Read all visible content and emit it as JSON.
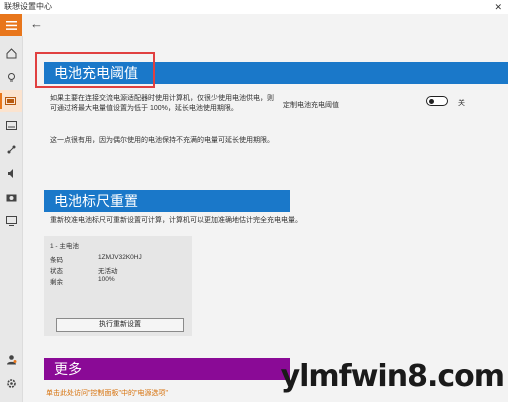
{
  "window": {
    "title": "联想设置中心",
    "close": "✕"
  },
  "nav": {
    "back": "←"
  },
  "section1": {
    "title": "电池充电阈值",
    "desc1": "如果主要在连接交流电源适配器时使用计算机，仅很少使用电池供电，则可通过将最大电量值设置为低于 100%，延长电池使用期限。",
    "desc2": "这一点很有用，因为偶尔使用的电池保持不充满的电量可延长使用期限。",
    "toggle_label": "定制电池充电阈值",
    "toggle_state": "关",
    "toggle_on": false
  },
  "section2": {
    "title": "电池标尺重置",
    "desc": "重新校准电池标尺可重新设置可计算，计算机可以更加准确地估计完全充电电量。",
    "battery": {
      "name": "1 - 主电池",
      "rows": [
        {
          "key": "条码",
          "value": "1ZMJV32K0HJ"
        },
        {
          "key": "状态",
          "value": "无活动"
        },
        {
          "key": "剩余",
          "value": "100%"
        }
      ],
      "button": "执行重新设置"
    }
  },
  "section3": {
    "title": "更多",
    "link": "单击此处访问\"控制面板\"中的\"电源选项\""
  },
  "watermark": {
    "text": "ylmfwin8.com"
  },
  "colors": {
    "accent_orange": "#e8761b",
    "blue_header": "#1a78c9",
    "purple_header": "#8a0a96",
    "link": "#d7720c",
    "highlight_red": "#e04040"
  }
}
